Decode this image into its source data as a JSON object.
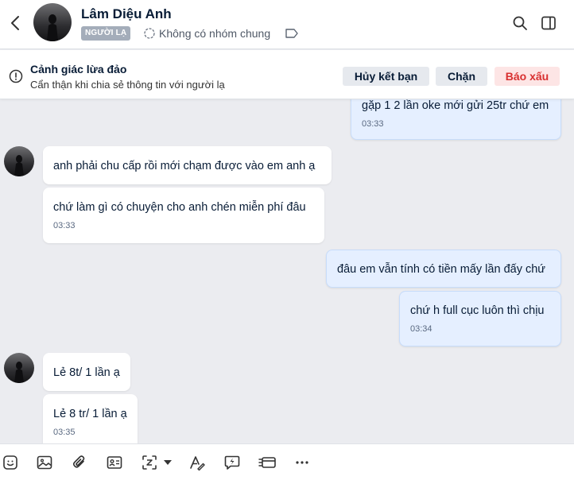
{
  "header": {
    "contact_name": "Lâm Diệu Anh",
    "stranger_badge": "NGƯỜI LẠ",
    "group_info": "Không có nhóm chung"
  },
  "warning": {
    "title": "Cảnh giác lừa đảo",
    "subtitle": "Cẩn thận khi chia sẻ thông tin với người lạ",
    "unfriend_label": "Hủy kết bạn",
    "block_label": "Chặn",
    "report_label": "Báo xấu"
  },
  "messages": [
    {
      "dir": "out",
      "text": "gặp 1 2 lần oke mới gửi 25tr chứ em",
      "time": "03:33"
    },
    {
      "dir": "in",
      "text": "anh phải chu cấp rồi mới chạm được vào em anh ạ",
      "time": ""
    },
    {
      "dir": "in",
      "text": "chứ làm gì có chuyện cho anh chén miễn phí đâu",
      "time": "03:33"
    },
    {
      "dir": "out",
      "text": "đâu em vẫn tính có tiền mấy lần đấy chứ",
      "time": ""
    },
    {
      "dir": "out",
      "text": "chứ h full cục luôn thì chịu",
      "time": "03:34"
    },
    {
      "dir": "in",
      "text": "Lẻ 8t/ 1 lần ạ",
      "time": ""
    },
    {
      "dir": "in",
      "text": "Lẻ 8 tr/ 1 lần ạ",
      "time": "03:35"
    }
  ],
  "colors": {
    "chat_bg": "#ebecf0",
    "outgoing_bubble": "#e5efff",
    "incoming_bubble": "#ffffff",
    "report_text": "#d83030"
  },
  "toolbar_icons": [
    "sticker-icon",
    "image-icon",
    "attachment-icon",
    "contact-card-icon",
    "screenshot-icon",
    "dropdown-icon",
    "format-text-icon",
    "quick-message-icon",
    "payment-card-icon",
    "more-icon"
  ]
}
